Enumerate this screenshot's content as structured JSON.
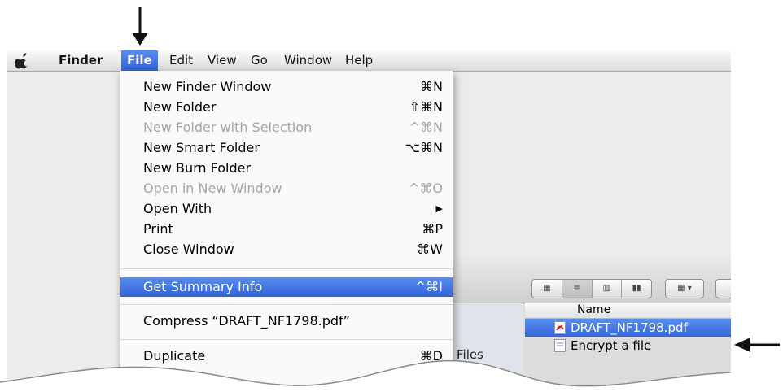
{
  "menubar": {
    "apple": "apple-menu",
    "items": [
      {
        "label": "Finder"
      },
      {
        "label": "File"
      },
      {
        "label": "Edit"
      },
      {
        "label": "View"
      },
      {
        "label": "Go"
      },
      {
        "label": "Window"
      },
      {
        "label": "Help"
      }
    ]
  },
  "file_menu": {
    "items": [
      {
        "label": "New Finder Window",
        "shortcut": "⌘N",
        "enabled": true
      },
      {
        "label": "New Folder",
        "shortcut": "⇧⌘N",
        "enabled": true
      },
      {
        "label": "New Folder with Selection",
        "shortcut": "^⌘N",
        "enabled": false
      },
      {
        "label": "New Smart Folder",
        "shortcut": "⌥⌘N",
        "enabled": true
      },
      {
        "label": "New Burn Folder",
        "shortcut": "",
        "enabled": true
      },
      {
        "label": "Open in New Window",
        "shortcut": "^⌘O",
        "enabled": false
      },
      {
        "label": "Open With",
        "shortcut": "▶",
        "enabled": true
      },
      {
        "label": "Print",
        "shortcut": "⌘P",
        "enabled": true
      },
      {
        "label": "Close Window",
        "shortcut": "⌘W",
        "enabled": true
      },
      {
        "label": "Get Summary Info",
        "shortcut": "^⌘I",
        "enabled": true,
        "highlighted": true
      },
      {
        "label": "Compress “DRAFT_NF1798.pdf”",
        "shortcut": "",
        "enabled": true
      },
      {
        "label": "Duplicate",
        "shortcut": "⌘D",
        "enabled": true
      }
    ]
  },
  "finder_window": {
    "sidebar_label": "Files",
    "column_header": "Name",
    "view_buttons": [
      "icon-view",
      "list-view",
      "column-view",
      "coverflow-view"
    ],
    "files": [
      {
        "name": "DRAFT_NF1798.pdf",
        "selected": true,
        "icon": "pdf-icon"
      },
      {
        "name": "Encrypt a file",
        "selected": false,
        "icon": "document-icon"
      }
    ]
  },
  "colors": {
    "highlight": "#3467d8",
    "menu_bg": "#fafafa"
  }
}
